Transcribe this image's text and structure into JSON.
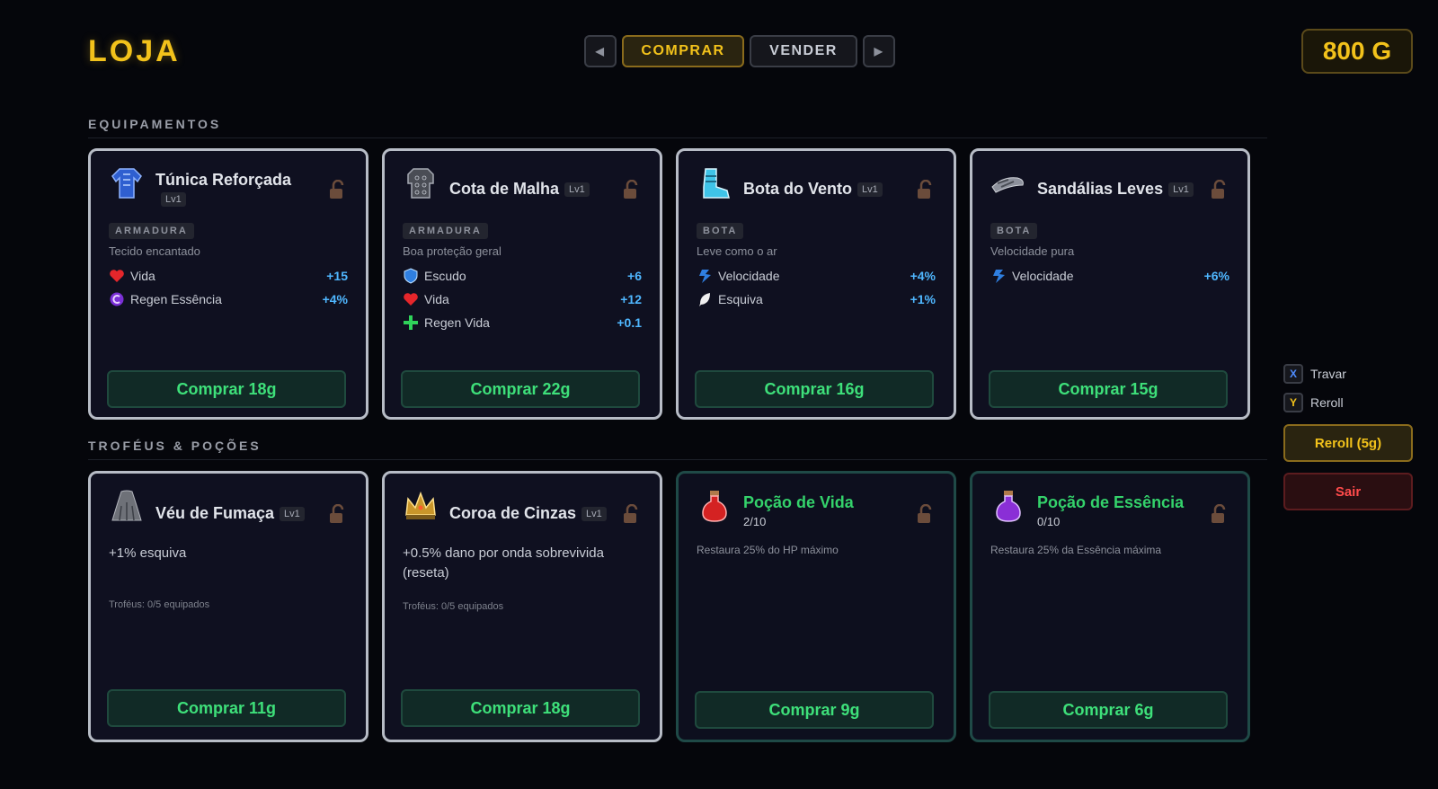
{
  "header": {
    "title": "LOJA",
    "gold": "800 G"
  },
  "tabs": {
    "prev": "◀",
    "buy": "COMPRAR",
    "sell": "VENDER",
    "next": "▶"
  },
  "sections": {
    "equipment": "EQUIPAMENTOS",
    "trophies": "TROFÉUS & POÇÕES"
  },
  "equipment": [
    {
      "name": "Túnica Reforçada",
      "level": "Lv1",
      "icon": "tunic-icon",
      "tag": "ARMADURA",
      "desc": "Tecido encantado",
      "stats": [
        {
          "icon": "heart-icon",
          "label": "Vida",
          "value": "+15"
        },
        {
          "icon": "essence-regen-icon",
          "label": "Regen Essência",
          "value": "+4%"
        }
      ],
      "buy": "Comprar 18g"
    },
    {
      "name": "Cota de Malha",
      "level": "Lv1",
      "icon": "chainmail-icon",
      "tag": "ARMADURA",
      "desc": "Boa proteção geral",
      "stats": [
        {
          "icon": "shield-icon",
          "label": "Escudo",
          "value": "+6"
        },
        {
          "icon": "heart-icon",
          "label": "Vida",
          "value": "+12"
        },
        {
          "icon": "plus-icon",
          "label": "Regen Vida",
          "value": "+0.1"
        }
      ],
      "buy": "Comprar 22g"
    },
    {
      "name": "Bota do Vento",
      "level": "Lv1",
      "icon": "boot-icon",
      "tag": "BOTA",
      "desc": "Leve como o ar",
      "stats": [
        {
          "icon": "speed-icon",
          "label": "Velocidade",
          "value": "+4%"
        },
        {
          "icon": "feather-icon",
          "label": "Esquiva",
          "value": "+1%"
        }
      ],
      "buy": "Comprar 16g"
    },
    {
      "name": "Sandálias Leves",
      "level": "Lv1",
      "icon": "sandals-icon",
      "tag": "BOTA",
      "desc": "Velocidade pura",
      "stats": [
        {
          "icon": "speed-icon",
          "label": "Velocidade",
          "value": "+6%"
        }
      ],
      "buy": "Comprar 15g"
    }
  ],
  "trophies": [
    {
      "name": "Véu de Fumaça",
      "level": "Lv1",
      "icon": "smoke-veil-icon",
      "desc": "+1% esquiva",
      "count": "Troféus: 0/5 equipados",
      "buy": "Comprar 11g"
    },
    {
      "name": "Coroa de Cinzas",
      "level": "Lv1",
      "icon": "crown-icon",
      "desc": "+0.5% dano por onda sobrevivida (reseta)",
      "count": "Troféus: 0/5 equipados",
      "buy": "Comprar 18g"
    }
  ],
  "potions": [
    {
      "name": "Poção de Vida",
      "icon": "red-potion-icon",
      "stock": "2/10",
      "desc": "Restaura 25% do HP máximo",
      "buy": "Comprar 9g"
    },
    {
      "name": "Poção de Essência",
      "icon": "purple-potion-icon",
      "stock": "0/10",
      "desc": "Restaura 25% da Essência máxima",
      "buy": "Comprar 6g"
    }
  ],
  "side": {
    "lock_key": "X",
    "lock_label": "Travar",
    "reroll_key": "Y",
    "reroll_label": "Reroll",
    "reroll_button": "Reroll (5g)",
    "exit_button": "Sair"
  },
  "colors": {
    "gold": "#f2c21b",
    "buy_green": "#3ee07a",
    "stat_blue": "#4fb7ff",
    "potion_green": "#34d26b",
    "exit_red": "#ff4b4b"
  }
}
